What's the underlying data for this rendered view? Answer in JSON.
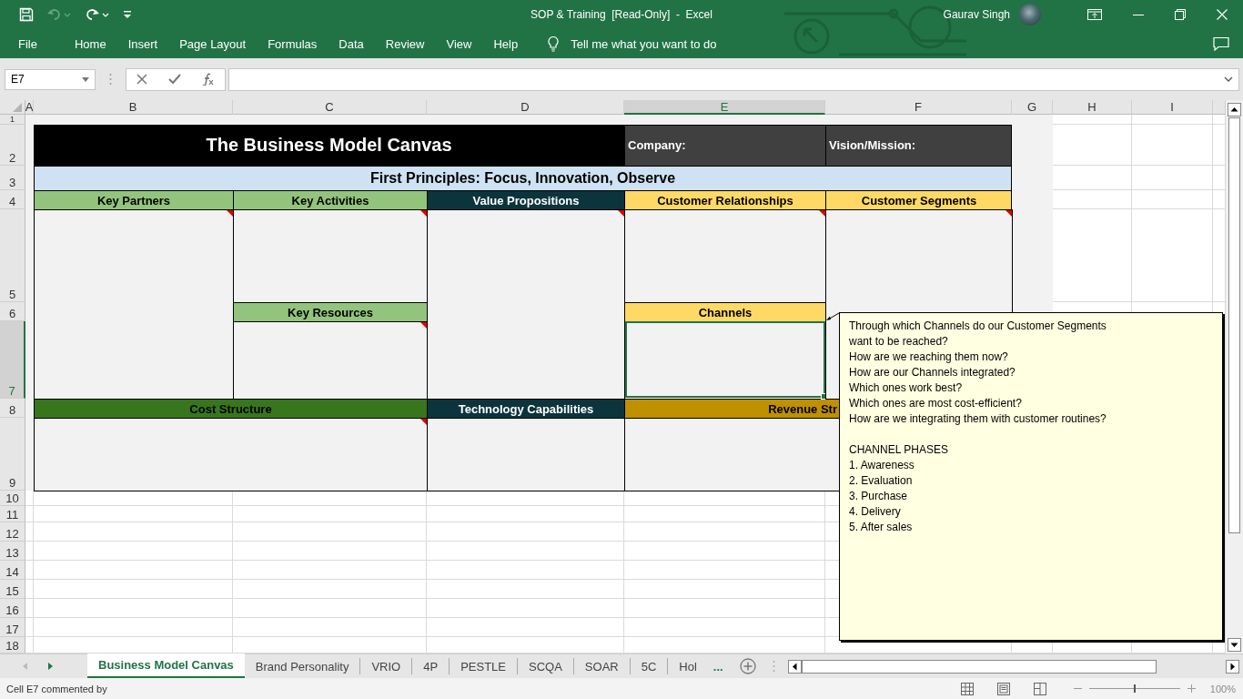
{
  "window": {
    "title": "SOP & Training  [Read-Only]  -  Excel",
    "user_name": "Gaurav Singh"
  },
  "quick_access": [
    {
      "kind": "save",
      "disabled": false
    },
    {
      "kind": "undo",
      "disabled": true
    },
    {
      "kind": "redo",
      "disabled": false
    },
    {
      "kind": "customize",
      "disabled": false
    }
  ],
  "ribbon_tabs": [
    {
      "label": "File"
    },
    {
      "label": "Home"
    },
    {
      "label": "Insert"
    },
    {
      "label": "Page Layout"
    },
    {
      "label": "Formulas"
    },
    {
      "label": "Data"
    },
    {
      "label": "Review"
    },
    {
      "label": "View"
    },
    {
      "label": "Help"
    }
  ],
  "tell_me": {
    "placeholder": "Tell me what you want to do"
  },
  "formula_bar": {
    "name_box": "E7"
  },
  "column_headers": [
    {
      "label": "A",
      "selected": false
    },
    {
      "label": "B",
      "selected": false
    },
    {
      "label": "C",
      "selected": false
    },
    {
      "label": "D",
      "selected": false
    },
    {
      "label": "E",
      "selected": true
    },
    {
      "label": "F",
      "selected": false
    },
    {
      "label": "G",
      "selected": false
    },
    {
      "label": "H",
      "selected": false
    },
    {
      "label": "I",
      "selected": false
    }
  ],
  "row_headers": [
    {
      "label": "1",
      "selected": false
    },
    {
      "label": "2",
      "selected": false
    },
    {
      "label": "3",
      "selected": false
    },
    {
      "label": "4",
      "selected": false
    },
    {
      "label": "5",
      "selected": false
    },
    {
      "label": "6",
      "selected": false
    },
    {
      "label": "7",
      "selected": true
    },
    {
      "label": "8",
      "selected": false
    },
    {
      "label": "9",
      "selected": false
    },
    {
      "label": "10",
      "selected": false
    },
    {
      "label": "11",
      "selected": false
    },
    {
      "label": "12",
      "selected": false
    },
    {
      "label": "13",
      "selected": false
    },
    {
      "label": "14",
      "selected": false
    },
    {
      "label": "15",
      "selected": false
    },
    {
      "label": "16",
      "selected": false
    },
    {
      "label": "17",
      "selected": false
    },
    {
      "label": "18",
      "selected": false
    }
  ],
  "canvas": {
    "title": "The Business Model Canvas",
    "company_label": "Company:",
    "vision_label": "Vision/Mission:",
    "principles": "First Principles: Focus, Innovation, Observe",
    "blocks": [
      {
        "label": "Key Partners",
        "color": "#93c47d",
        "comment": true,
        "selected": false
      },
      {
        "label": "Key Activities",
        "color": "#93c47d",
        "comment": true,
        "selected": false
      },
      {
        "label": "Key Resources",
        "color": "#93c47d",
        "comment": true,
        "selected": false
      },
      {
        "label": "Value Propositions",
        "color": "#0c343d",
        "comment": true,
        "selected": false
      },
      {
        "label": "Customer Relationships",
        "color": "#ffd966",
        "comment": true,
        "selected": false
      },
      {
        "label": "Channels",
        "color": "#ffd966",
        "comment": false,
        "selected": true
      },
      {
        "label": "Customer Segments",
        "color": "#ffd966",
        "comment": true,
        "selected": false
      },
      {
        "label": "Cost Structure",
        "color": "#38761d",
        "comment": true,
        "selected": false
      },
      {
        "label": "Technology Capabilities",
        "color": "#0c343d",
        "comment": false,
        "selected": false
      },
      {
        "label": "Revenue Str",
        "color": "#bf9000",
        "comment": false,
        "selected": false,
        "cut": true
      }
    ]
  },
  "comment": {
    "paragraphs": [
      {
        "lines": [
          "Through which Channels do our Customer Segments",
          "want to be reached?",
          "How are we reaching them now?",
          "How are our Channels integrated?",
          "Which ones work best?",
          "Which ones are most cost-efficient?",
          "How are we integrating them with customer routines?"
        ]
      },
      {
        "lines": [
          "CHANNEL PHASES",
          "1. Awareness",
          "2. Evaluation",
          "3. Purchase",
          "4. Delivery",
          "5. After sales"
        ]
      }
    ]
  },
  "sheet_tabs": [
    {
      "label": "Business Model Canvas",
      "selected": true
    },
    {
      "label": "Brand Personality",
      "selected": false
    },
    {
      "label": "VRIO",
      "selected": false
    },
    {
      "label": "4P",
      "selected": false
    },
    {
      "label": "PESTLE",
      "selected": false
    },
    {
      "label": "SCQA",
      "selected": false
    },
    {
      "label": "SOAR",
      "selected": false
    },
    {
      "label": "5C",
      "selected": false
    },
    {
      "label": "Hol",
      "selected": false
    }
  ],
  "more_tabs": "...",
  "status_bar": {
    "text": "Cell E7 commented by",
    "zoom": {
      "level": 0.5,
      "reading": "100%"
    }
  }
}
